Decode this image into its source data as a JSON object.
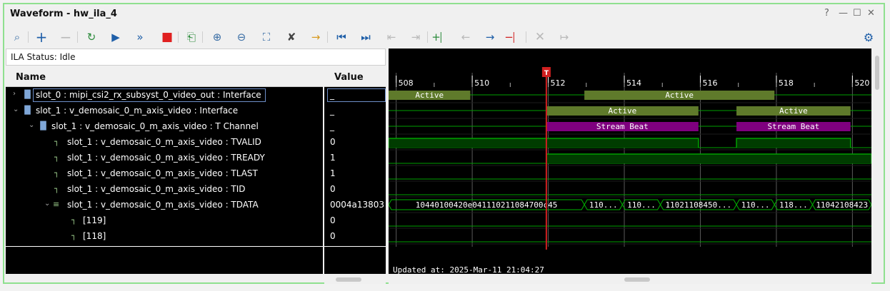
{
  "window": {
    "title": "Waveform - hw_ila_4",
    "controls": [
      "?",
      "—",
      "☐",
      "✕"
    ]
  },
  "status": {
    "label": "ILA Status: Idle"
  },
  "columns": {
    "name": "Name",
    "value": "Value"
  },
  "rows": [
    {
      "label": "slot_0 : mipi_csi2_rx_subsyst_0_video_out : Interface",
      "value": "_"
    },
    {
      "label": "slot_1 : v_demosaic_0_m_axis_video : Interface",
      "value": "_"
    },
    {
      "label": "slot_1 : v_demosaic_0_m_axis_video : T Channel",
      "value": "_"
    },
    {
      "label": "slot_1 : v_demosaic_0_m_axis_video : TVALID",
      "value": "0"
    },
    {
      "label": "slot_1 : v_demosaic_0_m_axis_video : TREADY",
      "value": "1"
    },
    {
      "label": "slot_1 : v_demosaic_0_m_axis_video : TLAST",
      "value": "1"
    },
    {
      "label": "slot_1 : v_demosaic_0_m_axis_video : TID",
      "value": "0"
    },
    {
      "label": "slot_1 : v_demosaic_0_m_axis_video : TDATA",
      "value": "0004a13803"
    },
    {
      "label": "[119]",
      "value": "0"
    },
    {
      "label": "[118]",
      "value": "0"
    }
  ],
  "timeline": {
    "ticks": [
      "508",
      "510",
      "512",
      "514",
      "516",
      "518",
      "520"
    ],
    "tick_values": [
      508,
      510,
      512,
      514,
      516,
      518,
      520
    ],
    "range": [
      507.8,
      520.5
    ],
    "trigger_time": 511.95,
    "trigger_label": "T",
    "updated": "Updated at: 2025-Mar-11 21:04:27"
  },
  "waves": {
    "slot0_active": [
      {
        "from": 507.8,
        "to": 509.95,
        "label": "Active"
      },
      {
        "from": 512.95,
        "to": 517.95,
        "label": "Active"
      }
    ],
    "slot1_active": [
      {
        "from": 511.95,
        "to": 515.95,
        "label": "Active"
      },
      {
        "from": 516.95,
        "to": 519.95,
        "label": "Active"
      }
    ],
    "tchannel": [
      {
        "from": 511.95,
        "to": 515.95,
        "label": "Stream Beat"
      },
      {
        "from": 516.95,
        "to": 519.95,
        "label": "Stream Beat"
      }
    ],
    "tvalid": [
      {
        "from": 507.8,
        "to": 515.95
      },
      {
        "from": 516.95,
        "to": 519.95
      }
    ],
    "tready": [
      {
        "from": 511.95,
        "to": 520.5
      }
    ],
    "tdata": [
      {
        "from": 507.8,
        "to": 512.95,
        "label": "10440100420e041110211084700c45"
      },
      {
        "from": 512.95,
        "to": 513.95,
        "label": "110..."
      },
      {
        "from": 513.95,
        "to": 514.95,
        "label": "110..."
      },
      {
        "from": 514.95,
        "to": 516.95,
        "label": "11021108450..."
      },
      {
        "from": 516.95,
        "to": 517.95,
        "label": "110..."
      },
      {
        "from": 517.95,
        "to": 518.95,
        "label": "118..."
      },
      {
        "from": 518.95,
        "to": 520.5,
        "label": "11042108423"
      }
    ]
  },
  "colors": {
    "active_bus": "#5f7a2b",
    "stream_beat": "#7f007f",
    "signal_high": "#00a000",
    "signal_fill": "#003c00",
    "trigger": "#d02020",
    "bus_outline": "#00b400"
  }
}
